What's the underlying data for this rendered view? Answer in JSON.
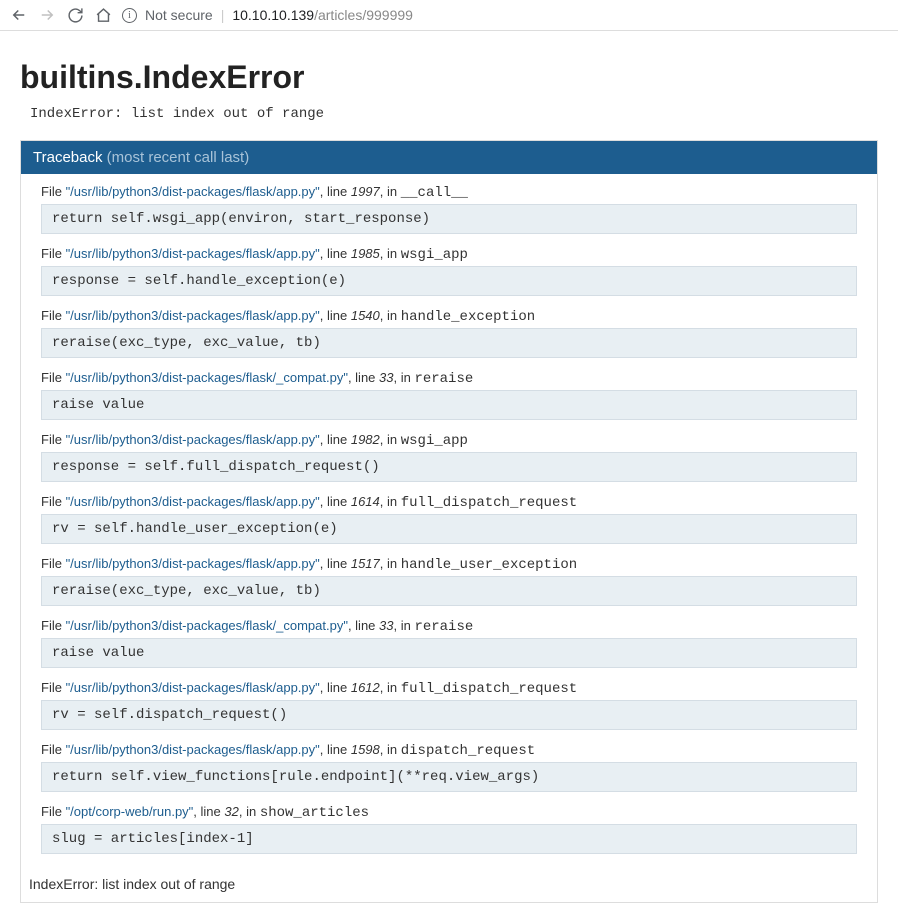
{
  "browser": {
    "not_secure_label": "Not secure",
    "url_host": "10.10.10.139",
    "url_path": "/articles/999999"
  },
  "error": {
    "title": "builtins.IndexError",
    "message": "IndexError: list index out of range"
  },
  "traceback": {
    "header_label": "Traceback",
    "header_sub": "(most recent call last)",
    "final_error": "IndexError: list index out of range",
    "frames": [
      {
        "file_label": "File",
        "path": "\"/usr/lib/python3/dist-packages/flask/app.py\"",
        "line_label": ", line",
        "line": "1997",
        "in_label": ", in",
        "func": "__call__",
        "code": "return self.wsgi_app(environ, start_response)"
      },
      {
        "file_label": "File",
        "path": "\"/usr/lib/python3/dist-packages/flask/app.py\"",
        "line_label": ", line",
        "line": "1985",
        "in_label": ", in",
        "func": "wsgi_app",
        "code": "response = self.handle_exception(e)"
      },
      {
        "file_label": "File",
        "path": "\"/usr/lib/python3/dist-packages/flask/app.py\"",
        "line_label": ", line",
        "line": "1540",
        "in_label": ", in",
        "func": "handle_exception",
        "code": "reraise(exc_type, exc_value, tb)"
      },
      {
        "file_label": "File",
        "path": "\"/usr/lib/python3/dist-packages/flask/_compat.py\"",
        "line_label": ", line",
        "line": "33",
        "in_label": ", in",
        "func": "reraise",
        "code": "raise value"
      },
      {
        "file_label": "File",
        "path": "\"/usr/lib/python3/dist-packages/flask/app.py\"",
        "line_label": ", line",
        "line": "1982",
        "in_label": ", in",
        "func": "wsgi_app",
        "code": "response = self.full_dispatch_request()"
      },
      {
        "file_label": "File",
        "path": "\"/usr/lib/python3/dist-packages/flask/app.py\"",
        "line_label": ", line",
        "line": "1614",
        "in_label": ", in",
        "func": "full_dispatch_request",
        "code": "rv = self.handle_user_exception(e)"
      },
      {
        "file_label": "File",
        "path": "\"/usr/lib/python3/dist-packages/flask/app.py\"",
        "line_label": ", line",
        "line": "1517",
        "in_label": ", in",
        "func": "handle_user_exception",
        "code": "reraise(exc_type, exc_value, tb)"
      },
      {
        "file_label": "File",
        "path": "\"/usr/lib/python3/dist-packages/flask/_compat.py\"",
        "line_label": ", line",
        "line": "33",
        "in_label": ", in",
        "func": "reraise",
        "code": "raise value"
      },
      {
        "file_label": "File",
        "path": "\"/usr/lib/python3/dist-packages/flask/app.py\"",
        "line_label": ", line",
        "line": "1612",
        "in_label": ", in",
        "func": "full_dispatch_request",
        "code": "rv = self.dispatch_request()"
      },
      {
        "file_label": "File",
        "path": "\"/usr/lib/python3/dist-packages/flask/app.py\"",
        "line_label": ", line",
        "line": "1598",
        "in_label": ", in",
        "func": "dispatch_request",
        "code": "return self.view_functions[rule.endpoint](**req.view_args)"
      },
      {
        "file_label": "File",
        "path": "\"/opt/corp-web/run.py\"",
        "line_label": ", line",
        "line": "32",
        "in_label": ", in",
        "func": "show_articles",
        "code": "slug = articles[index-1]"
      }
    ]
  }
}
